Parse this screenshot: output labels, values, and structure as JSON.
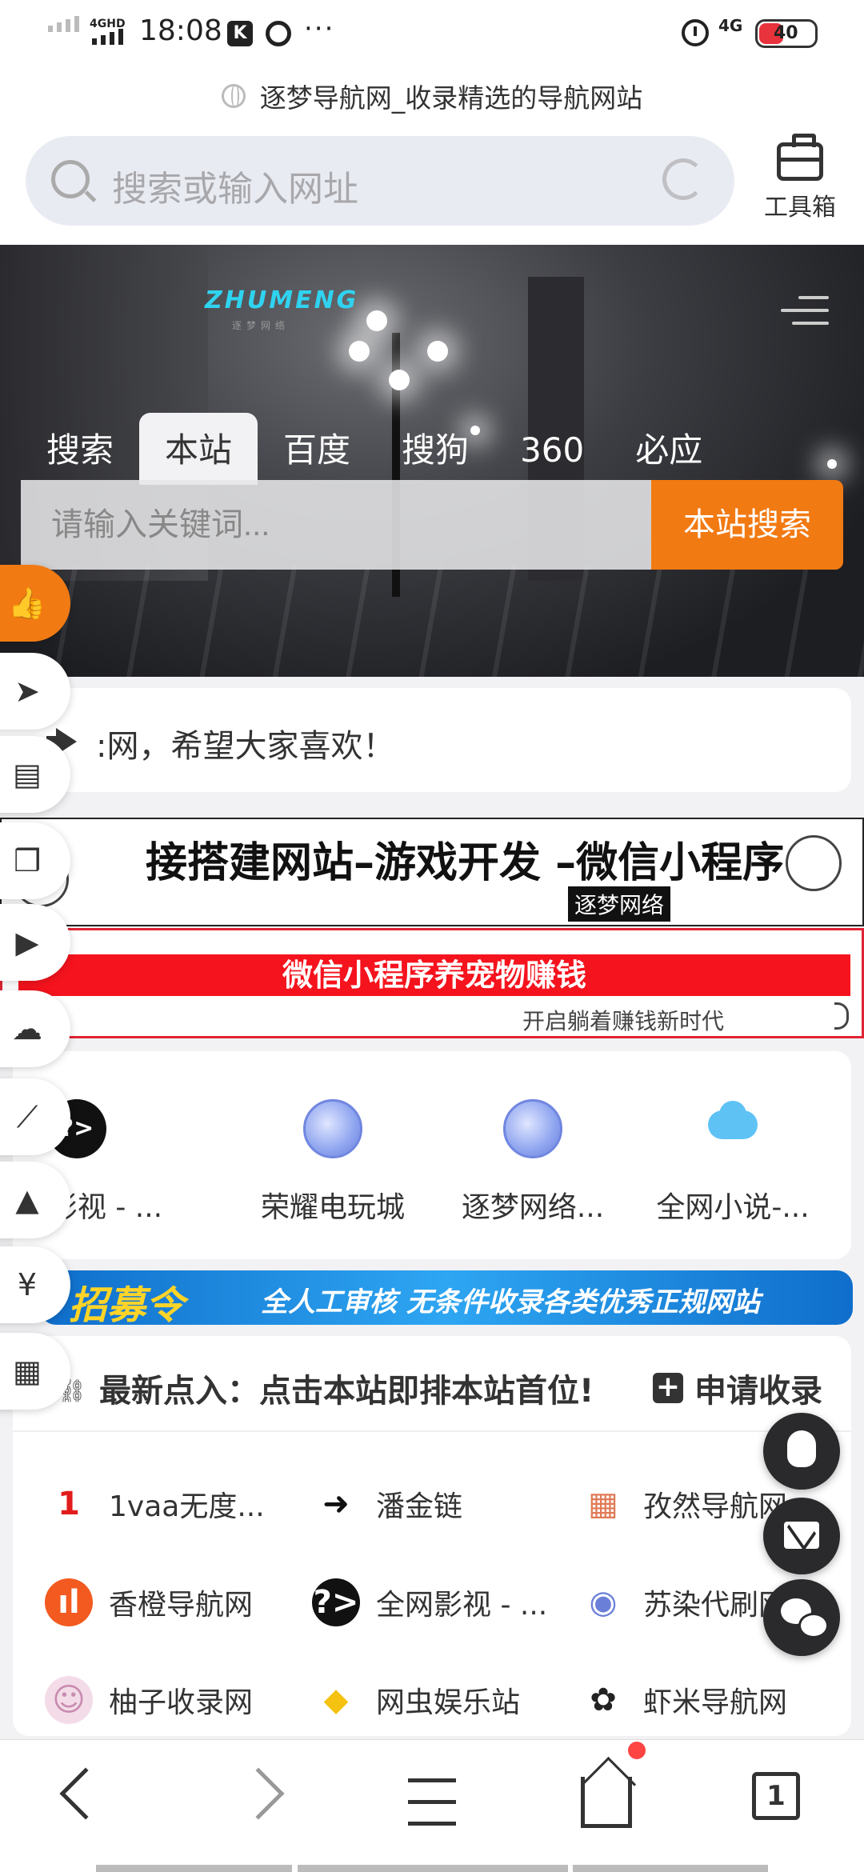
{
  "status_bar": {
    "network": "4GHD",
    "time": "18:08",
    "app_icon_k": "K",
    "more": "···",
    "lte": "4G",
    "battery": "40"
  },
  "page": {
    "title": "逐梦导航网_收录精选的导航网站"
  },
  "browser": {
    "search_placeholder": "搜索或输入网址",
    "toolbox_label": "工具箱"
  },
  "hero": {
    "logo": "ZHUMENG",
    "logo_sub": "逐梦网络",
    "tabs": [
      {
        "label": "搜索",
        "active": false
      },
      {
        "label": "本站",
        "active": true
      },
      {
        "label": "百度",
        "active": false
      },
      {
        "label": "搜狗",
        "active": false
      },
      {
        "label": "360",
        "active": false
      },
      {
        "label": "必应",
        "active": false
      }
    ],
    "search_placeholder": "请输入关键词...",
    "search_button": "本站搜索"
  },
  "side_bar": {
    "items": [
      {
        "name": "thumbs-up-icon",
        "glyph": "👍"
      },
      {
        "name": "paper-plane-icon",
        "glyph": "➤"
      },
      {
        "name": "document-icon",
        "glyph": "▤"
      },
      {
        "name": "cubes-icon",
        "glyph": "❒"
      },
      {
        "name": "video-icon",
        "glyph": "▶"
      },
      {
        "name": "cloud-icon",
        "glyph": "☁"
      },
      {
        "name": "chart-icon",
        "glyph": "⟋"
      },
      {
        "name": "graduation-cap-icon",
        "glyph": "▲"
      },
      {
        "name": "yen-icon",
        "glyph": "¥"
      },
      {
        "name": "grid-icon",
        "glyph": "▦"
      }
    ]
  },
  "notice": {
    "text": ":网，希望大家喜欢！"
  },
  "banners": {
    "dev": {
      "title": "接搭建网站–游戏开发 –微信小程序",
      "tag": "逐梦网络"
    },
    "pet": {
      "title": "微信小程序养宠物赚钱",
      "subtitle": "开启躺着赚钱新时代"
    }
  },
  "hot_sites": [
    {
      "name": "全网影视 - ...",
      "icon": "dark-play-icon",
      "glyph": "?>"
    },
    {
      "name": "荣耀电玩城",
      "icon": "globe-icon",
      "glyph": ""
    },
    {
      "name": "逐梦网络...",
      "icon": "globe-icon",
      "glyph": ""
    },
    {
      "name": "全网小说-...",
      "icon": "cloud-rain-icon",
      "glyph": ""
    }
  ],
  "recruit": {
    "title": "招募令",
    "message": "全人工审核  无条件收录各类优秀正规网站"
  },
  "latest": {
    "title": "最新点入：点击本站即排本站首位!",
    "apply_label": "申请收录",
    "links": [
      {
        "name": "1vaa无度...",
        "glyph": "1",
        "color": "#e21c1c",
        "bg": "#ffffff"
      },
      {
        "name": "潘金链",
        "glyph": "➜",
        "color": "#111111",
        "bg": "#ffffff"
      },
      {
        "name": "孜然导航网",
        "glyph": "▦",
        "color": "#e07a55",
        "bg": "#ffffff"
      },
      {
        "name": "香橙导航网",
        "glyph": "ıl",
        "color": "#ffffff",
        "bg": "#f25a1f"
      },
      {
        "name": "全网影视 - ...",
        "glyph": "?>",
        "color": "#ffffff",
        "bg": "#111111"
      },
      {
        "name": "苏染代刷网",
        "glyph": "◉",
        "color": "#6a7fd8",
        "bg": "#ffffff"
      },
      {
        "name": "柚子收录网",
        "glyph": "☺",
        "color": "#c98bb0",
        "bg": "#f3dce8"
      },
      {
        "name": "网虫娱乐站",
        "glyph": "◆",
        "color": "#f5c211",
        "bg": "#ffffff"
      },
      {
        "name": "虾米导航网",
        "glyph": "✿",
        "color": "#222222",
        "bg": "#ffffff"
      }
    ]
  },
  "float_buttons": [
    "qq-icon",
    "mail-icon",
    "wechat-icon"
  ],
  "bottom_nav": {
    "tab_count": "1"
  },
  "colors": {
    "accent": "#f27a13",
    "logo": "#2fd3f0",
    "pet_banner": "#f5131d",
    "recruit": "#2ea6f2"
  }
}
